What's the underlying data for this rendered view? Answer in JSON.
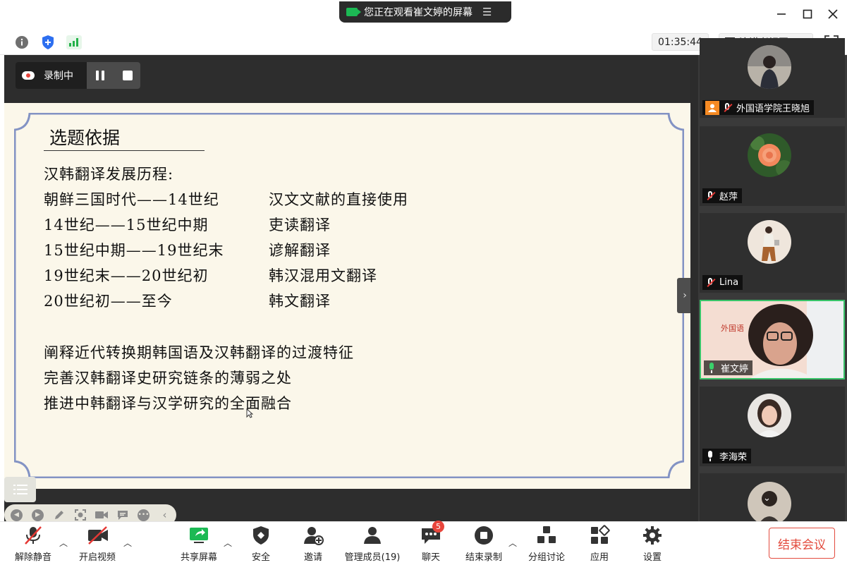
{
  "window": {
    "viewing_banner": "您正在观看崔文婷的屏幕",
    "minimize_icon": "minimize-icon",
    "maximize_icon": "maximize-icon",
    "close_icon": "close-icon"
  },
  "infobar": {
    "meeting_info_icon": "info-icon",
    "security_icon": "shield-icon",
    "signal_icon": "signal-bars-icon",
    "elapsed_time": "01:35:44",
    "view_mode": "演讲者视图",
    "fullscreen_icon": "fullscreen-icon"
  },
  "recording": {
    "label": "录制中",
    "pause_icon": "pause-icon",
    "stop_icon": "stop-icon"
  },
  "slide": {
    "title": "选题依据",
    "heading": "汉韩翻译发展历程:",
    "timeline": [
      {
        "period": "朝鲜三国时代——14世纪",
        "form": "汉文文献的直接使用"
      },
      {
        "period": "14世纪——15世纪中期",
        "form": "吏读翻译"
      },
      {
        "period": "15世纪中期——19世纪末",
        "form": "谚解翻译"
      },
      {
        "period": "19世纪末——20世纪初",
        "form": "韩汉混用文翻译"
      },
      {
        "period": "20世纪初——至今",
        "form": "韩文翻译"
      }
    ],
    "points": [
      "阐释近代转换期韩国语及汉韩翻译的过渡特征",
      "完善汉韩翻译史研究链条的薄弱之处",
      "推进中韩翻译与汉学研究的全面融合"
    ]
  },
  "participants": [
    {
      "name": "外国语学院王晓旭",
      "audio": "muted"
    },
    {
      "name": "赵萍",
      "audio": "muted"
    },
    {
      "name": "Lina",
      "audio": "muted"
    },
    {
      "name": "崔文婷",
      "audio": "speaking",
      "video_bg_text": "外国语"
    },
    {
      "name": "李海荣",
      "audio": "unmuted"
    }
  ],
  "toolbar": {
    "unmute": "解除静音",
    "start_video": "开启视频",
    "share_screen": "共享屏幕",
    "security": "安全",
    "invite": "邀请",
    "manage_participants": "管理成员(19)",
    "chat": "聊天",
    "chat_badge": "5",
    "stop_recording": "结束录制",
    "breakout_rooms": "分组讨论",
    "apps": "应用",
    "settings": "设置",
    "end_meeting": "结束会议"
  },
  "colors": {
    "accent_green": "#39c46a",
    "end_red": "#e34b3e",
    "slide_bg": "#fbf7ea",
    "slide_frame": "#8393c4"
  }
}
